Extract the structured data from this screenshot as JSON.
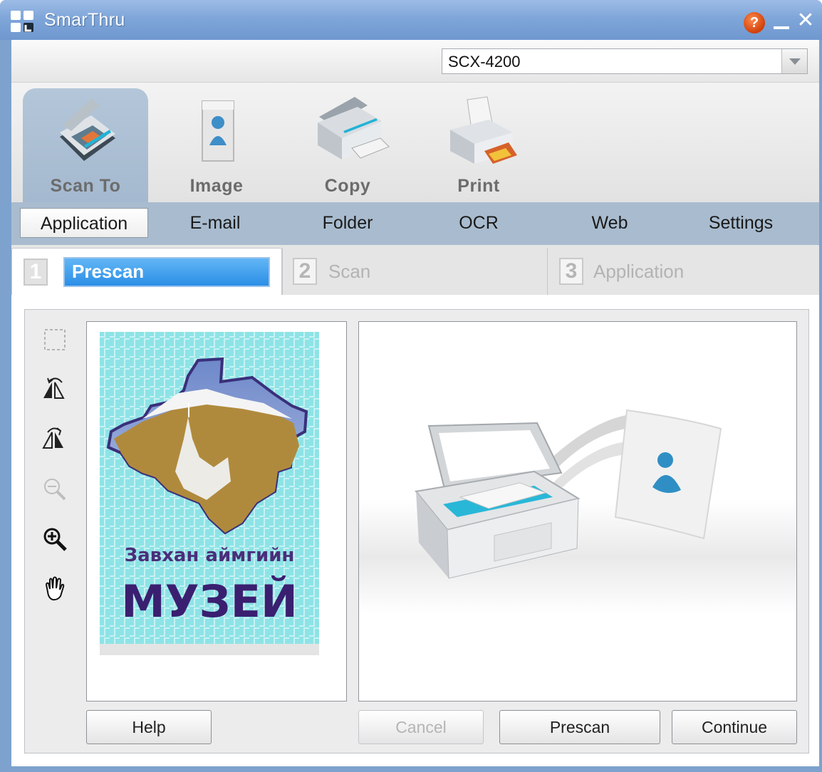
{
  "window": {
    "title": "SmarThru"
  },
  "toolbar": {
    "model_value": "SCX-4200"
  },
  "main_tabs": [
    {
      "label": "Scan To",
      "active": true
    },
    {
      "label": "Image",
      "active": false
    },
    {
      "label": "Copy",
      "active": false
    },
    {
      "label": "Print",
      "active": false
    }
  ],
  "sub_tabs": [
    {
      "label": "Application",
      "active": true
    },
    {
      "label": "E-mail",
      "active": false
    },
    {
      "label": "Folder",
      "active": false
    },
    {
      "label": "OCR",
      "active": false
    },
    {
      "label": "Web",
      "active": false
    },
    {
      "label": "Settings",
      "active": false
    }
  ],
  "steps": [
    {
      "number": "1",
      "label": "Prescan",
      "active": true
    },
    {
      "number": "2",
      "label": "Scan",
      "active": false
    },
    {
      "number": "3",
      "label": "Application",
      "active": false
    }
  ],
  "preview": {
    "line1": "Завхан аймгийн",
    "line2": "МУЗЕЙ"
  },
  "tools": [
    {
      "name": "select-area-icon",
      "enabled": false
    },
    {
      "name": "rotate-left-icon",
      "enabled": true
    },
    {
      "name": "rotate-right-icon",
      "enabled": true
    },
    {
      "name": "zoom-out-icon",
      "enabled": false
    },
    {
      "name": "zoom-in-icon",
      "enabled": true
    },
    {
      "name": "hand-pan-icon",
      "enabled": true
    }
  ],
  "buttons": {
    "help": "Help",
    "cancel": "Cancel",
    "prescan": "Prescan",
    "continue": "Continue"
  },
  "colors": {
    "title_bar": "#7fa6d9",
    "sub_tab_bar": "#a9bccf",
    "active_step": "#2b8ee6",
    "preview_background": "#8ee3e6"
  }
}
